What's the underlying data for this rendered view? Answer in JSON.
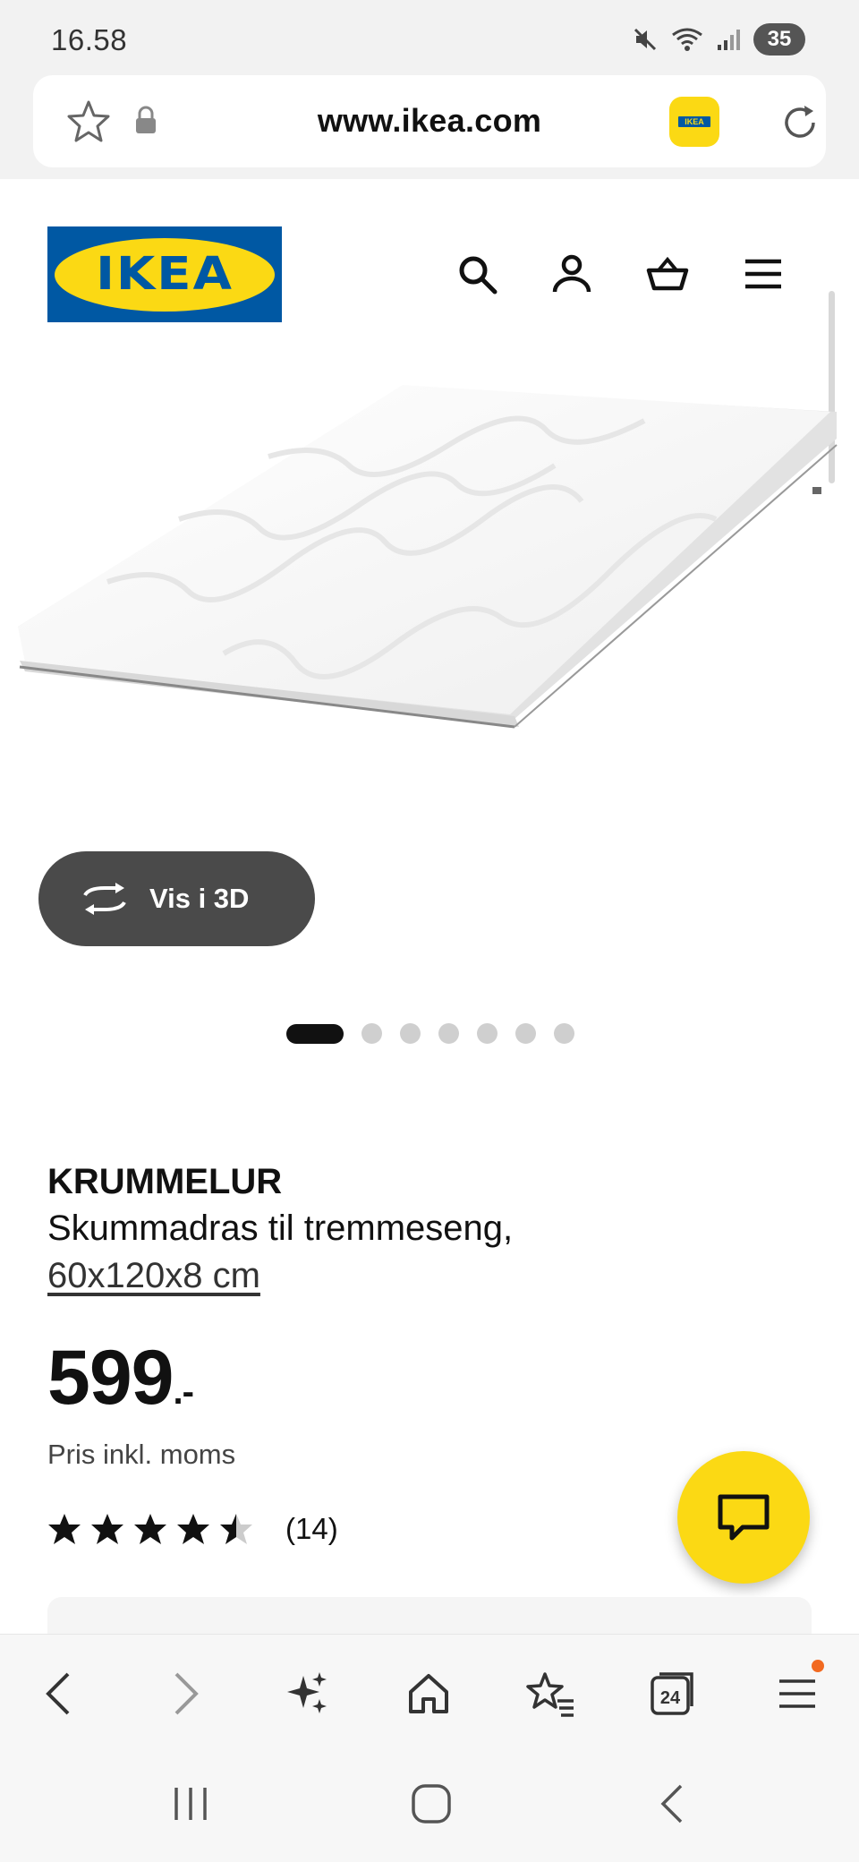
{
  "status_bar": {
    "time": "16.58",
    "battery": "35"
  },
  "browser": {
    "url": "www.ikea.com",
    "tab_count": "24"
  },
  "brand": {
    "logo_text": "IKEA",
    "blue": "#0058a3",
    "yellow": "#fbd914"
  },
  "gallery": {
    "view_3d_label": "Vis i 3D",
    "image_count": 7,
    "active_index": 0
  },
  "product": {
    "name": "KRUMMELUR",
    "description": "Skummadras til tremmeseng,",
    "size": "60x120x8 cm",
    "price": "599",
    "price_suffix": ".-",
    "vat_note": "Pris inkl. moms",
    "rating": 4.5,
    "rating_max": 5,
    "review_count": "(14)"
  },
  "icons": {
    "header": [
      "search-icon",
      "account-icon",
      "basket-icon",
      "menu-icon"
    ],
    "browser_bar": [
      "back-icon",
      "forward-icon",
      "ai-sparkle-icon",
      "home-icon",
      "bookmarks-icon",
      "tabs-icon",
      "menu-icon"
    ],
    "system_nav": [
      "recents-icon",
      "home-icon",
      "back-icon"
    ]
  }
}
